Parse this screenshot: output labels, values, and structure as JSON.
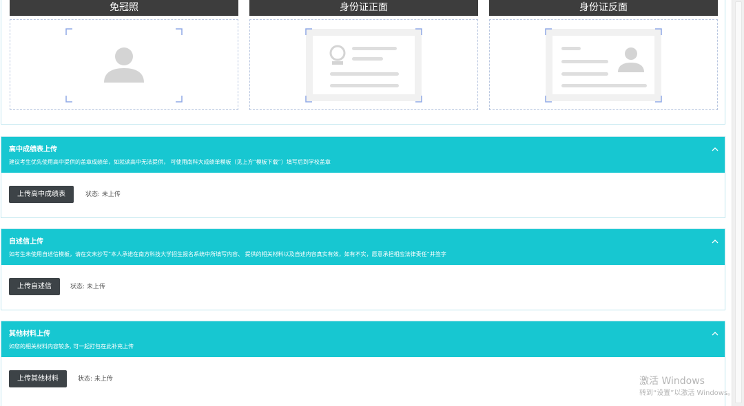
{
  "photos": [
    {
      "title": "免冠照",
      "icon": "portrait-placeholder-icon"
    },
    {
      "title": "身份证正面",
      "icon": "id-card-front-placeholder-icon"
    },
    {
      "title": "身份证反面",
      "icon": "id-card-back-placeholder-icon"
    }
  ],
  "sections": [
    {
      "title": "高中成绩表上传",
      "desc": "建议考生优先使用高中提供的盖章成绩单，如就读高中无法提供， 可使用南科大成绩单模板（见上方“模板下载”）填写后到学校盖章",
      "button": "上传高中成绩表",
      "status": "状态: 未上传"
    },
    {
      "title": "自述信上传",
      "desc": "如考生未使用自述信模板，请在文末抄写“本人承诺在南方科技大学招生报名系统中所填写内容、 提供的相关材料以及自述内容真实有效，如有不实，愿意承担相应法律责任”并签字",
      "button": "上传自述信",
      "status": "状态: 未上传"
    },
    {
      "title": "其他材料上传",
      "desc": "如您的相关材料内容较多, 可一起打包在此补充上传",
      "button": "上传其他材料",
      "status": "状态: 未上传"
    }
  ],
  "watermark": {
    "title": "激活 Windows",
    "subtitle": "转到“设置”以激活 Windows。"
  },
  "colors": {
    "header_bg": "#3d3d3d",
    "section_bg": "#17c7d1",
    "button_bg": "#3d4347",
    "corner_accent": "#8fa9e6"
  }
}
